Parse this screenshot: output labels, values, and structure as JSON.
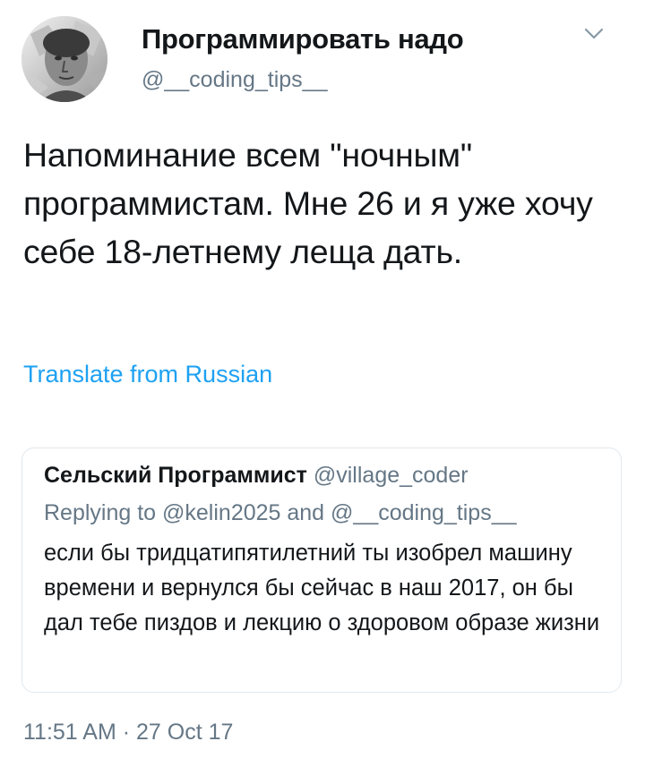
{
  "tweet": {
    "author": {
      "display_name": "Программировать надо",
      "handle": "@__coding_tips__",
      "avatar_icon": "profile-photo"
    },
    "menu_icon": "chevron-down-icon",
    "text": "Напоминание всем \"ночным\" программистам. Мне 26 и я уже хочу себе 18-летнему леща дать.",
    "translate_label": "Translate from Russian",
    "timestamp": "11:51 AM · 27 Oct 17"
  },
  "quoted_tweet": {
    "display_name": "Сельский Программист",
    "handle": "@village_coder",
    "replying_to": "Replying to @kelin2025 and @__coding_tips__",
    "text": "если бы тридцатипятилетний ты изобрел машину времени и вернулся бы сейчас в наш 2017, он бы дал тебе пиздов и лекцию о здоровом образе жизни"
  },
  "colors": {
    "text_primary": "#14171a",
    "text_secondary": "#657786",
    "link": "#1da1f2",
    "border": "#e1e8ed"
  }
}
